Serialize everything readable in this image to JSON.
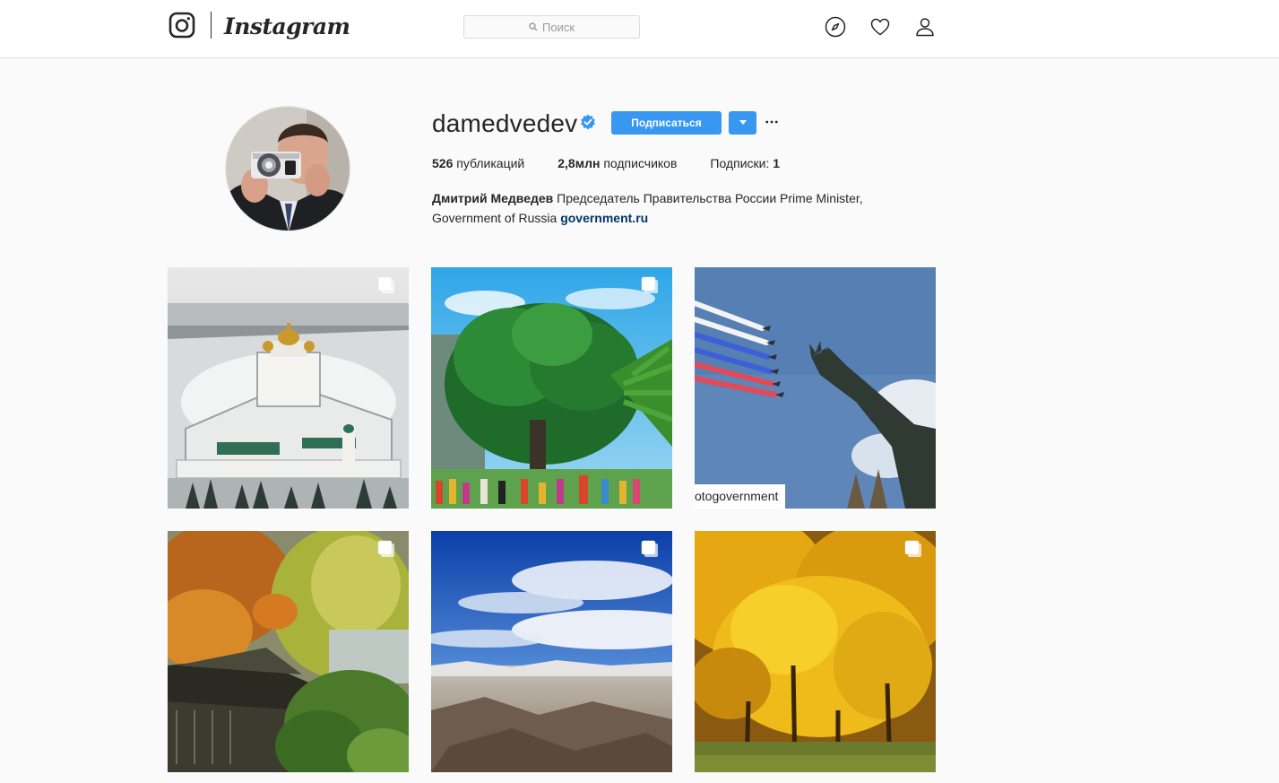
{
  "nav": {
    "brand": "Instagram",
    "search_placeholder": "Поиск",
    "icons": [
      "instagram-glyph-icon",
      "search-icon",
      "compass-icon",
      "heart-icon",
      "person-icon"
    ]
  },
  "profile": {
    "username": "damedvedev",
    "verified": true,
    "follow_label": "Подписаться",
    "stats": {
      "posts_value": "526",
      "posts_label": "публикаций",
      "followers_value": "2,8млн",
      "followers_label": "подписчиков",
      "following_label": "Подписки:",
      "following_value": "1"
    },
    "bio": {
      "name": "Дмитрий Медведев",
      "text": "Председатель Правительства России Prime Minister, Government of Russia",
      "link": "government.ru"
    }
  },
  "posts": [
    {
      "subject": "winter monastery aerial",
      "multiple": true
    },
    {
      "subject": "tree with dancers",
      "multiple": true
    },
    {
      "subject": "air show over statue",
      "multiple": false,
      "watermark": "otogovernment"
    },
    {
      "subject": "autumn garden pagoda",
      "multiple": true
    },
    {
      "subject": "sky over mountains",
      "multiple": true
    },
    {
      "subject": "yellow autumn trees",
      "multiple": true
    }
  ],
  "colors": {
    "accent": "#3897f0",
    "link": "#003569",
    "border": "#dbdbdb",
    "background": "#fafafa"
  }
}
